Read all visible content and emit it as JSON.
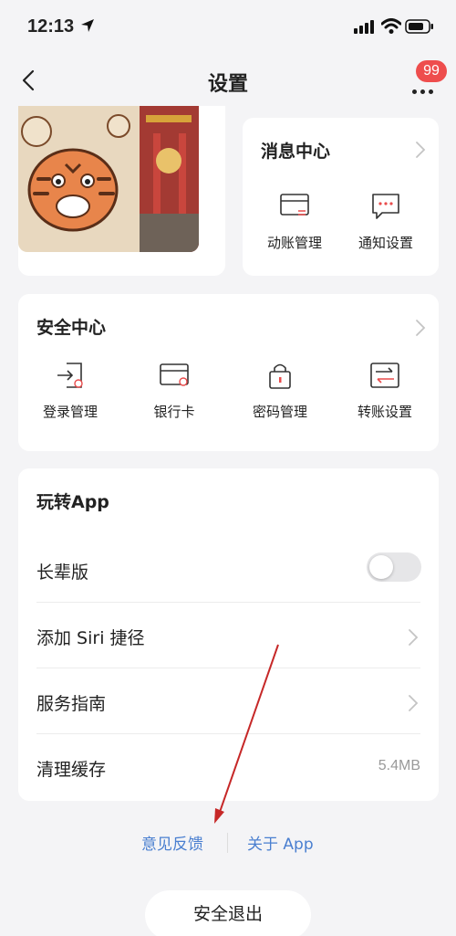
{
  "status_bar": {
    "time": "12:13"
  },
  "nav": {
    "title": "设置",
    "badge_count": "99"
  },
  "message_center": {
    "title": "消息中心",
    "items": [
      {
        "label": "动账管理",
        "icon": "card-transfer-icon"
      },
      {
        "label": "通知设置",
        "icon": "chat-bubble-icon"
      }
    ]
  },
  "security_center": {
    "title": "安全中心",
    "items": [
      {
        "label": "登录管理",
        "icon": "login-icon"
      },
      {
        "label": "银行卡",
        "icon": "bank-card-icon"
      },
      {
        "label": "密码管理",
        "icon": "lock-icon"
      },
      {
        "label": "转账设置",
        "icon": "transfer-icon"
      }
    ]
  },
  "play_app": {
    "title": "玩转App",
    "rows": [
      {
        "label": "长辈版",
        "type": "toggle",
        "on": false
      },
      {
        "label": "添加 Siri 捷径",
        "type": "link"
      },
      {
        "label": "服务指南",
        "type": "link"
      },
      {
        "label": "清理缓存",
        "type": "value",
        "value": "5.4MB"
      }
    ]
  },
  "footer": {
    "feedback": "意见反馈",
    "about": "关于 App"
  },
  "logout_label": "安全退出",
  "colors": {
    "accent_red": "#e94b4b",
    "link_blue": "#4a7fd0",
    "background": "#f4f4f6"
  }
}
